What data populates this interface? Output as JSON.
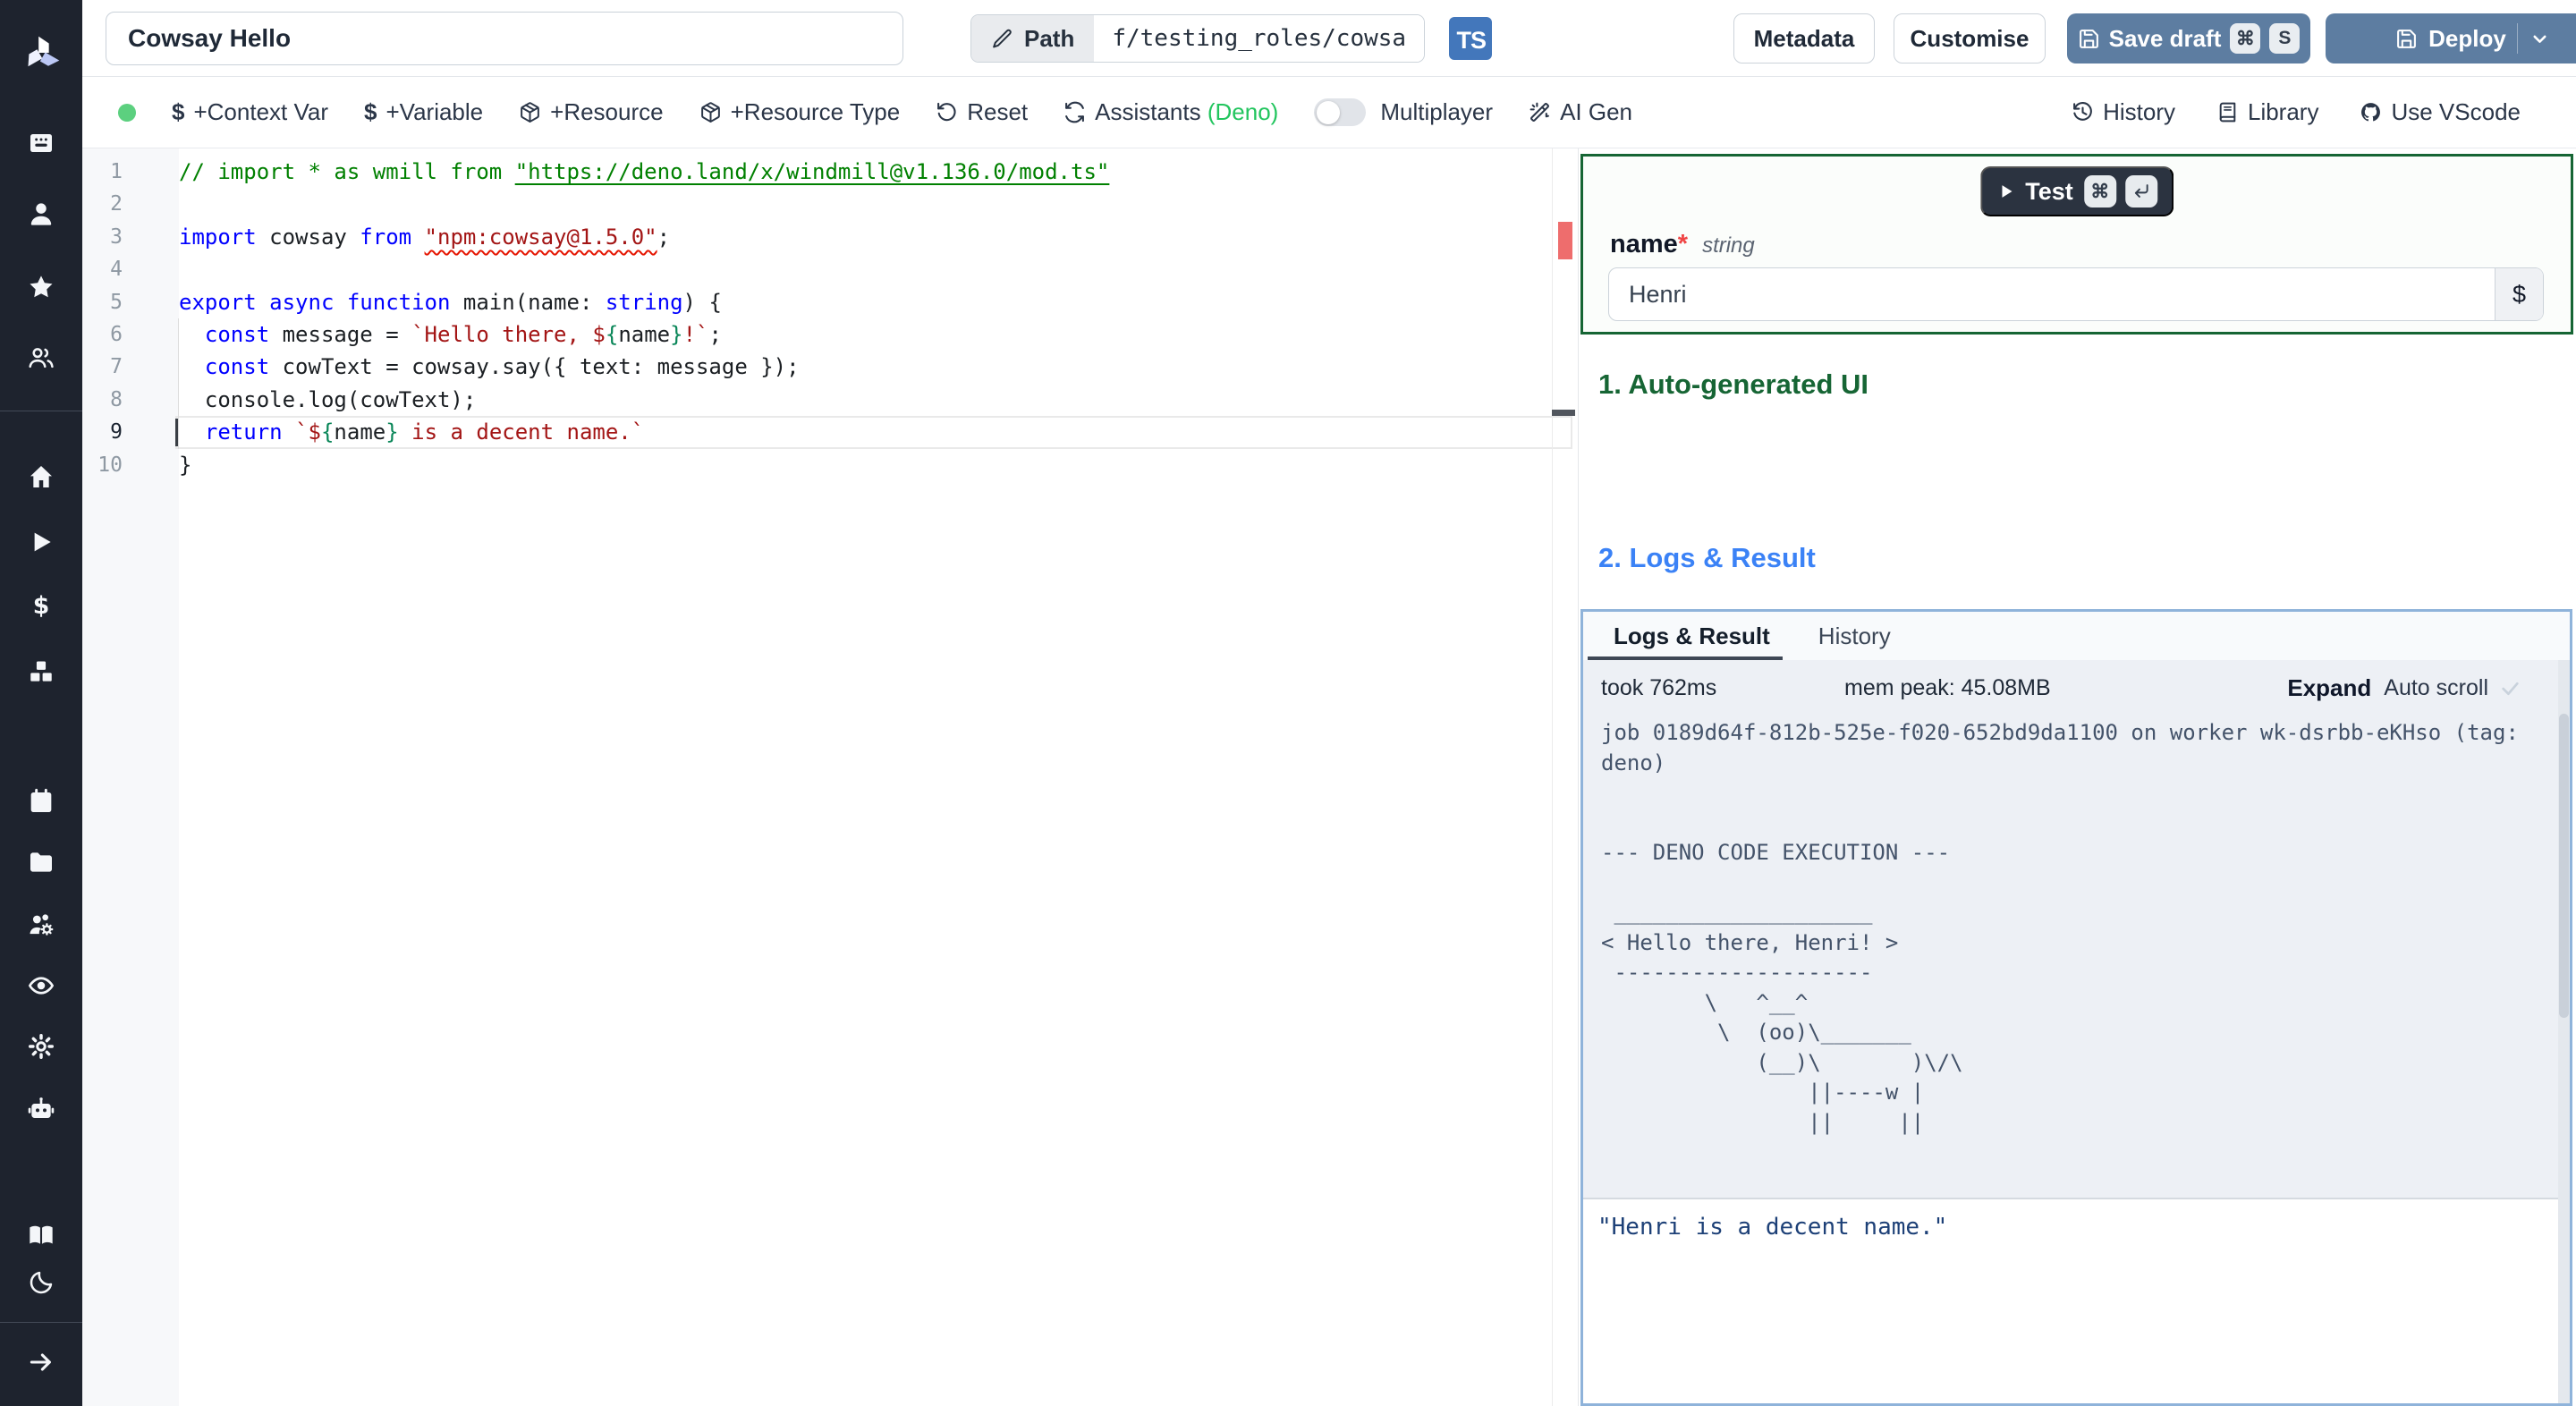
{
  "topbar": {
    "title_value": "Cowsay Hello",
    "path_label": "Path",
    "path_value": "f/testing_roles/cowsa",
    "lang_badge": "TS",
    "metadata": "Metadata",
    "customise": "Customise",
    "save_draft": "Save draft",
    "save_key_mod": "⌘",
    "save_key": "S",
    "deploy": "Deploy"
  },
  "toolbar": {
    "context_var": "+Context Var",
    "variable": "+Variable",
    "resource": "+Resource",
    "resource_type": "+Resource Type",
    "reset": "Reset",
    "assistants": "Assistants",
    "assistants_lang": "(Deno)",
    "multiplayer": "Multiplayer",
    "ai_gen": "AI Gen",
    "history": "History",
    "library": "Library",
    "use_vscode": "Use VScode"
  },
  "sidebar": {
    "items": [
      "kiosk",
      "user",
      "star",
      "users",
      "home",
      "play",
      "dollar",
      "boxes",
      "calendar",
      "folder",
      "users-cog",
      "eye",
      "settings",
      "bot",
      "book-open",
      "moon",
      "arrow-right"
    ]
  },
  "editor": {
    "lines": [
      {
        "n": "1",
        "tokens": [
          [
            "cmt",
            "// import * as wmill from "
          ],
          [
            "cmt lnk",
            "\"https://deno.land/x/windmill@v1.136.0/mod.ts\""
          ]
        ]
      },
      {
        "n": "2",
        "tokens": []
      },
      {
        "n": "3",
        "tokens": [
          [
            "kw",
            "import"
          ],
          [
            "df",
            " cowsay "
          ],
          [
            "kw",
            "from"
          ],
          [
            "df",
            " "
          ],
          [
            "str sqg",
            "\"npm:cowsay@1.5.0\""
          ],
          [
            "df",
            ";"
          ]
        ]
      },
      {
        "n": "4",
        "tokens": []
      },
      {
        "n": "5",
        "tokens": [
          [
            "kw",
            "export"
          ],
          [
            "df",
            " "
          ],
          [
            "kw",
            "async"
          ],
          [
            "df",
            " "
          ],
          [
            "kw",
            "function"
          ],
          [
            "df",
            " main(name: "
          ],
          [
            "kw",
            "string"
          ],
          [
            "df",
            ") {"
          ]
        ]
      },
      {
        "n": "6",
        "tokens": [
          [
            "df",
            "  "
          ],
          [
            "kw",
            "const"
          ],
          [
            "df",
            " message = "
          ],
          [
            "str",
            "`Hello there, $"
          ],
          [
            "expr",
            "{"
          ],
          [
            "df",
            "name"
          ],
          [
            "expr",
            "}"
          ],
          [
            "str",
            "!`"
          ],
          [
            "df",
            ";"
          ]
        ]
      },
      {
        "n": "7",
        "tokens": [
          [
            "df",
            "  "
          ],
          [
            "kw",
            "const"
          ],
          [
            "df",
            " cowText = cowsay.say({ text: message })"
          ],
          [
            "df",
            ";"
          ]
        ]
      },
      {
        "n": "8",
        "tokens": [
          [
            "df",
            "  console.log(cowText);"
          ]
        ]
      },
      {
        "n": "9",
        "active": true,
        "tokens": [
          [
            "df",
            "  "
          ],
          [
            "kw",
            "return"
          ],
          [
            "df",
            " "
          ],
          [
            "str",
            "`$"
          ],
          [
            "expr",
            "{"
          ],
          [
            "df",
            "name"
          ],
          [
            "expr",
            "}"
          ],
          [
            "str",
            " is a decent name.`"
          ]
        ]
      },
      {
        "n": "10",
        "tokens": [
          [
            "df",
            "}"
          ]
        ]
      }
    ]
  },
  "form": {
    "test": "Test",
    "test_key_mod": "⌘",
    "field_label": "name",
    "required": "*",
    "field_type": "string",
    "field_value": "Henri",
    "insert_var": "$"
  },
  "sections": {
    "auto_ui": "1. Auto-generated UI",
    "logs_result": "2. Logs & Result"
  },
  "logs": {
    "tab_active": "Logs & Result",
    "tab_history": "History",
    "took": "took 762ms",
    "mem": "mem peak: 45.08MB",
    "expand": "Expand",
    "autoscroll": "Auto scroll",
    "log_lines": [
      "job 0189d64f-812b-525e-f020-652bd9da1100 on worker wk-dsrbb-eKHso (tag:",
      "deno)",
      "",
      "",
      "--- DENO CODE EXECUTION ---",
      "",
      " ____________________",
      "< Hello there, Henri! >",
      " --------------------",
      "        \\   ^__^",
      "         \\  (oo)\\_______",
      "            (__)\\       )\\/\\",
      "                ||----w |",
      "                ||     ||"
    ],
    "result_value": "\"Henri is a decent name.\""
  },
  "colors": {
    "accent_green": "#166534",
    "accent_blue": "#3b82f6",
    "button_blue": "#5d7da1",
    "ts_badge": "#4377bb",
    "deno_green": "#22c55e",
    "status_dot": "#5cd07f",
    "error_marker": "#ee6d6d",
    "sidebar_bg": "#1e232e"
  }
}
